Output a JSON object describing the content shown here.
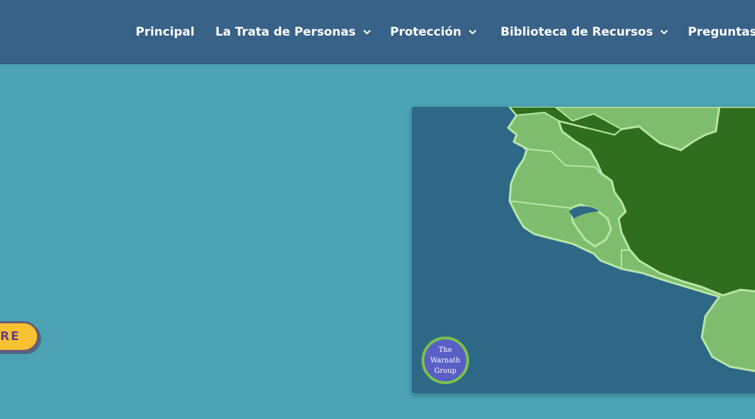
{
  "nav": {
    "items": [
      {
        "label": "Principal",
        "has_dropdown": false
      },
      {
        "label": "La Trata de Personas",
        "has_dropdown": true
      },
      {
        "label": "Protección",
        "has_dropdown": true
      },
      {
        "label": "Biblioteca de Recursos",
        "has_dropdown": true
      },
      {
        "label": "Preguntas",
        "has_dropdown": false
      }
    ]
  },
  "cta": {
    "label": "ORE"
  },
  "map": {
    "badge": {
      "line1": "The",
      "line2": "Warnath",
      "line3": "Group"
    },
    "colors": {
      "ocean": "#2e6887",
      "land_light": "#7dbd6d",
      "land_dark": "#2e6e1e",
      "border": "#b9e6a4"
    }
  },
  "icons": [
    "chevron-down-icon"
  ],
  "colors": {
    "header": "#386287",
    "background": "#4ba3b4",
    "cta": "#f7c231"
  }
}
